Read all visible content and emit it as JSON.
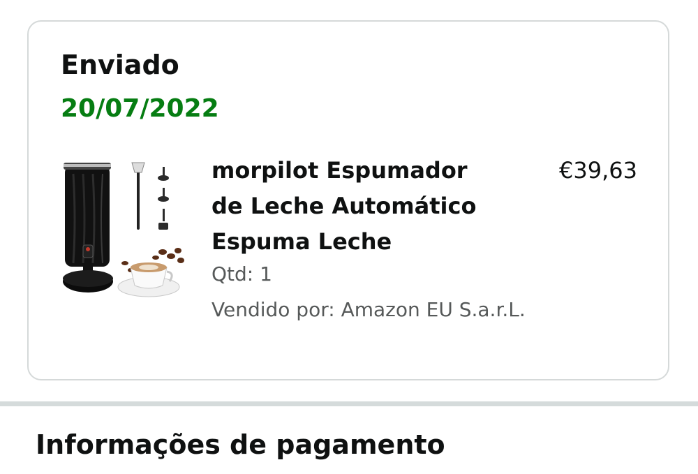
{
  "shipment": {
    "status": "Enviado",
    "date": "20/07/2022",
    "status_color": "#067d12"
  },
  "item": {
    "title": "morpilot Espumador de Leche Automático Espuma Leche",
    "price": "€39,63",
    "quantity": "Qtd: 1",
    "seller": "Vendido por: Amazon EU S.a.r.L.",
    "image_icon": "milk-frother-product-image"
  },
  "payment": {
    "heading": "Informações de pagamento"
  }
}
